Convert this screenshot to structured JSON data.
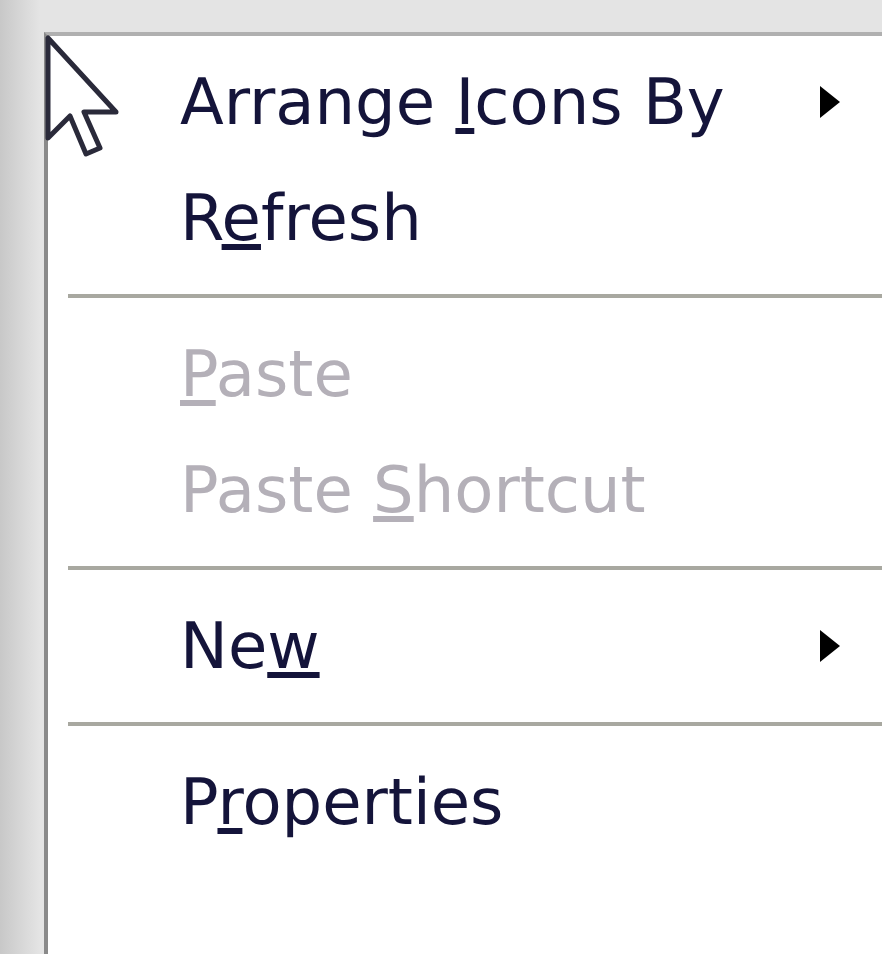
{
  "menu": {
    "items": [
      {
        "kind": "item",
        "label_before": "Arrange ",
        "access_key": "I",
        "label_after": "cons By",
        "disabled": false,
        "submenu": true
      },
      {
        "kind": "item",
        "label_before": "R",
        "access_key": "e",
        "label_after": "fresh",
        "disabled": false,
        "submenu": false
      },
      {
        "kind": "separator"
      },
      {
        "kind": "item",
        "access_key": "P",
        "label_after": "aste",
        "disabled": true,
        "submenu": false
      },
      {
        "kind": "item",
        "label_before": "Paste ",
        "access_key": "S",
        "label_after": "hortcut",
        "disabled": true,
        "submenu": false
      },
      {
        "kind": "separator"
      },
      {
        "kind": "item",
        "label_before": "Ne",
        "access_key": "w",
        "disabled": false,
        "submenu": true
      },
      {
        "kind": "separator"
      },
      {
        "kind": "item",
        "label_before": "P",
        "access_key": "r",
        "label_after": "operties",
        "disabled": false,
        "submenu": false
      }
    ]
  }
}
